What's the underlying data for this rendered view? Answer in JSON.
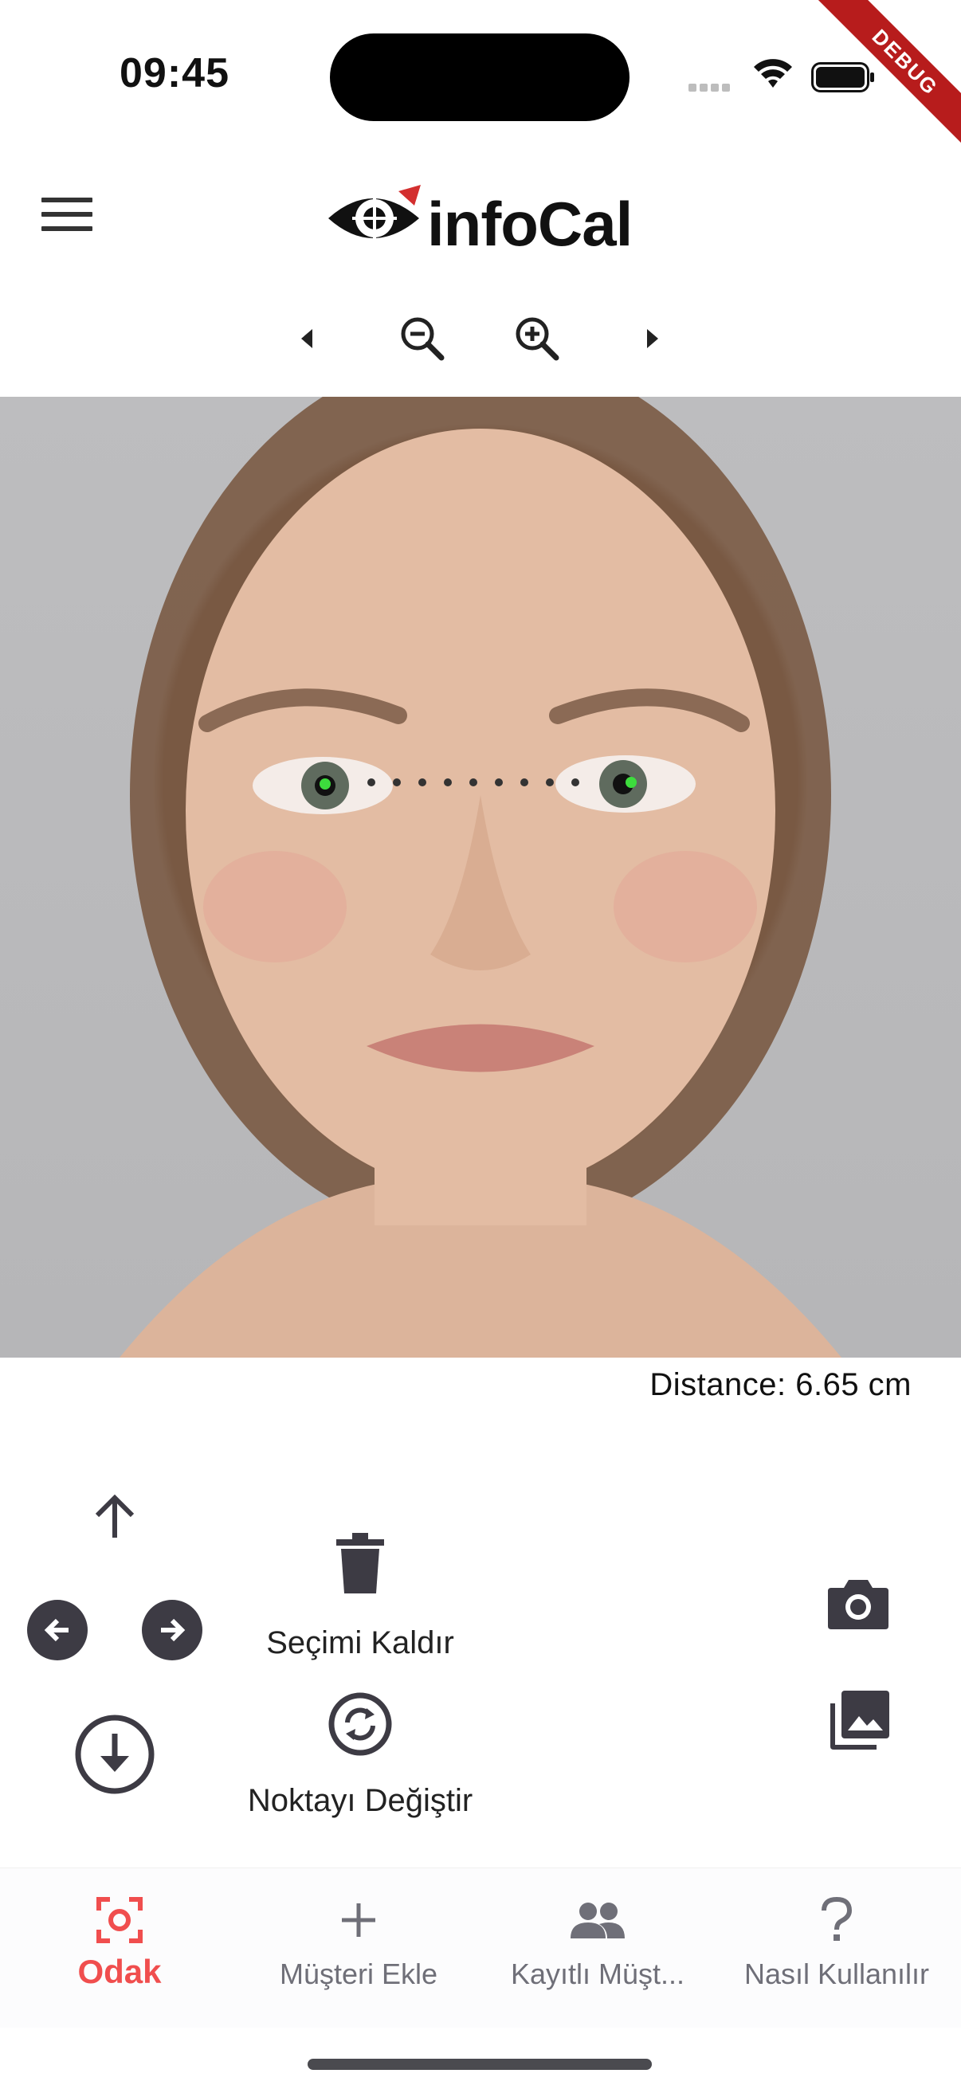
{
  "status_bar": {
    "time": "09:45"
  },
  "debug_ribbon": "DEBUG",
  "app_bar": {
    "logo_text": "infoCal"
  },
  "toolbar": {
    "icons": [
      "chevron-left-icon",
      "zoom-out-icon",
      "zoom-in-icon",
      "chevron-right-icon"
    ]
  },
  "measurement": {
    "distance_text": "Distance: 6.65 cm",
    "point_color": "#3ddc3d"
  },
  "controls": {
    "remove_selection_label": "Seçimi Kaldır",
    "change_point_label": "Noktayı Değiştir"
  },
  "bottom_nav": {
    "items": [
      {
        "label": "Odak",
        "icon": "focus-icon",
        "active": true
      },
      {
        "label": "Müşteri Ekle",
        "icon": "plus-icon",
        "active": false
      },
      {
        "label": "Kayıtlı Müşt...",
        "icon": "people-icon",
        "active": false
      },
      {
        "label": "Nasıl Kullanılır",
        "icon": "question-icon",
        "active": false
      }
    ]
  },
  "colors": {
    "accent": "#f04e4e",
    "icon_dark": "#3d3b44",
    "nav_inactive": "#6f6f78"
  }
}
